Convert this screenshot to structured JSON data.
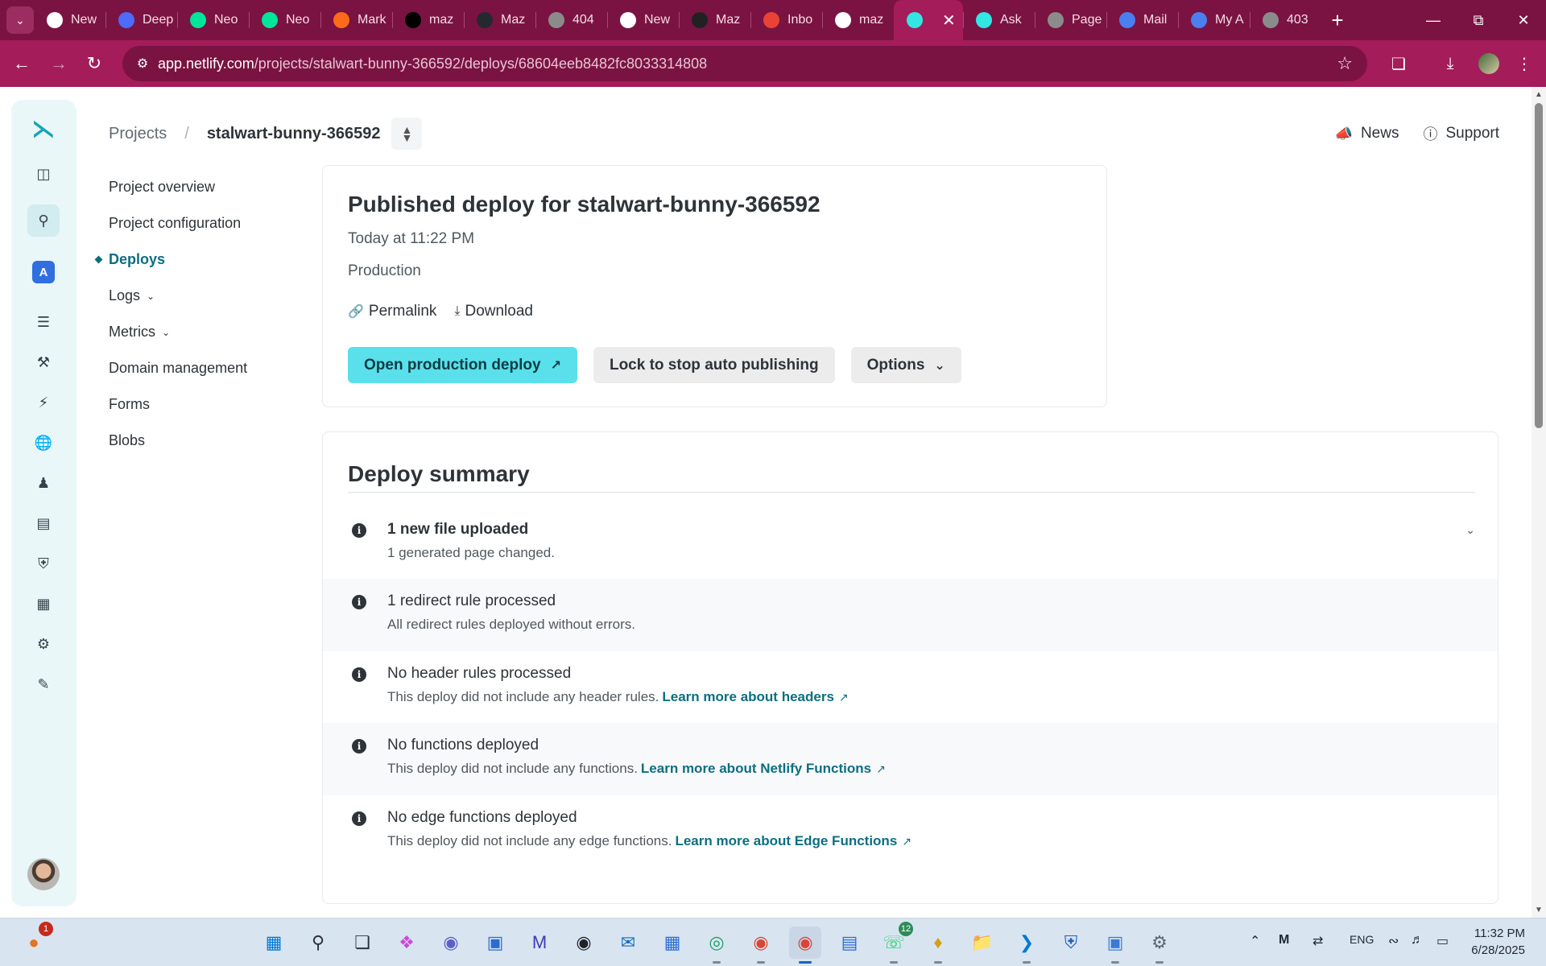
{
  "browser": {
    "tabs": [
      {
        "title": "New",
        "icon": "chrome-icon",
        "color": "#ffffff"
      },
      {
        "title": "Deep",
        "icon": "deepseek-icon",
        "color": "#4d6bfe"
      },
      {
        "title": "Neo",
        "icon": "neon-icon",
        "color": "#00e599"
      },
      {
        "title": "Neo",
        "icon": "neon-icon",
        "color": "#00e599"
      },
      {
        "title": "Mark",
        "icon": "markdown-icon",
        "color": "#ff6a1a"
      },
      {
        "title": "maz",
        "icon": "vercel-icon",
        "color": "#000000"
      },
      {
        "title": "Maz",
        "icon": "github-icon",
        "color": "#24292f"
      },
      {
        "title": "404",
        "icon": "globe-icon",
        "color": "#8b8b8b"
      },
      {
        "title": "New",
        "icon": "chrome-icon",
        "color": "#ffffff"
      },
      {
        "title": "Maz",
        "icon": "chatgpt-icon",
        "color": "#202123"
      },
      {
        "title": "Inbo",
        "icon": "gmail-icon",
        "color": "#ea4335"
      },
      {
        "title": "maz",
        "icon": "flutter-icon",
        "color": "#ffffff"
      },
      {
        "title": "",
        "icon": "netlify-icon",
        "color": "#32e6e2",
        "active": true
      },
      {
        "title": "Ask",
        "icon": "netlify-ask-icon",
        "color": "#32e6e2"
      },
      {
        "title": "Page",
        "icon": "globe-icon",
        "color": "#8b8b8b"
      },
      {
        "title": "Mail",
        "icon": "grid-icon",
        "color": "#4a7ff0"
      },
      {
        "title": "My A",
        "icon": "grid-icon",
        "color": "#4a7ff0"
      },
      {
        "title": "403",
        "icon": "globe-icon",
        "color": "#8b8b8b"
      }
    ],
    "url_host": "app.netlify.com",
    "url_path": "/projects/stalwart-bunny-366592/deploys/68604eeb8482fc8033314808"
  },
  "breadcrumb": {
    "root": "Projects",
    "separator": "/",
    "project": "stalwart-bunny-366592"
  },
  "toplinks": {
    "news": "News",
    "support": "Support"
  },
  "sidenav": {
    "items": [
      {
        "label": "Project overview",
        "name": "project-overview"
      },
      {
        "label": "Project configuration",
        "name": "project-configuration"
      },
      {
        "label": "Deploys",
        "name": "deploys",
        "active": true
      },
      {
        "label": "Logs",
        "name": "logs",
        "expandable": true
      },
      {
        "label": "Metrics",
        "name": "metrics",
        "expandable": true
      },
      {
        "label": "Domain management",
        "name": "domain-management"
      },
      {
        "label": "Forms",
        "name": "forms"
      },
      {
        "label": "Blobs",
        "name": "blobs"
      }
    ]
  },
  "deploy": {
    "title": "Published deploy for stalwart-bunny-366592",
    "time": "Today at 11:22 PM",
    "context": "Production",
    "permalink_label": "Permalink",
    "download_label": "Download",
    "open_label": "Open production deploy",
    "lock_label": "Lock to stop auto publishing",
    "options_label": "Options"
  },
  "summary": {
    "title": "Deploy summary",
    "rows": [
      {
        "heading": "1 new file uploaded",
        "detail": "1 generated page changed.",
        "link": "",
        "expandable": true,
        "bold": true
      },
      {
        "heading": "1 redirect rule processed",
        "detail": "All redirect rules deployed without errors.",
        "link": ""
      },
      {
        "heading": "No header rules processed",
        "detail": "This deploy did not include any header rules.",
        "link": "Learn more about headers"
      },
      {
        "heading": "No functions deployed",
        "detail": "This deploy did not include any functions.",
        "link": "Learn more about Netlify Functions"
      },
      {
        "heading": "No edge functions deployed",
        "detail": "This deploy did not include any edge functions.",
        "link": "Learn more about Edge Functions"
      }
    ]
  },
  "taskbar": {
    "notification_count": "1",
    "whatsapp_count": "12",
    "language": "ENG",
    "time": "11:32 PM",
    "date": "6/28/2025"
  },
  "colors": {
    "browser_frame": "#a51c5a",
    "accent_teal": "#0d6e80",
    "primary_button": "#5ae0ea",
    "rail_background": "#e9f7f9"
  }
}
